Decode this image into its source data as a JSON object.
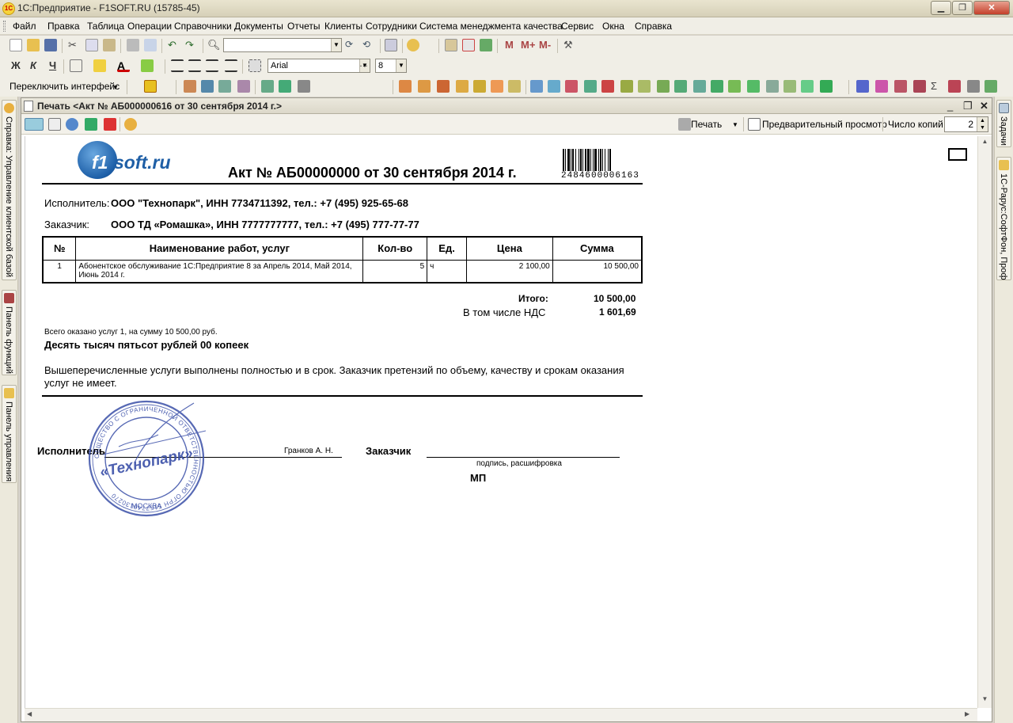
{
  "window": {
    "title": "1С:Предприятие - F1SOFT.RU (15785-45)"
  },
  "menu": [
    "Файл",
    "Правка",
    "Таблица",
    "Операции",
    "Справочники",
    "Документы",
    "Отчеты",
    "Клиенты",
    "Сотрудники",
    "Система менеджмента качества",
    "Сервис",
    "Окна",
    "Справка"
  ],
  "format_toolbar": {
    "font_name": "Arial",
    "font_size": "8",
    "bold_letter": "Ж",
    "italic_letter": "К",
    "underline_letter": "Ч"
  },
  "main_toolbar": {
    "m_label": "M",
    "m_plus_label": "M+",
    "m_minus_label": "M-"
  },
  "interface_toolbar": {
    "switch_label": "Переключить интерфейс"
  },
  "left_panels": [
    "Справка: Управление клиентской базой",
    "Панель функций",
    "Панель управления"
  ],
  "right_panels": [
    "Задачи",
    "1С-Рарус:СофтФон, Проф"
  ],
  "doc_window": {
    "title": "Печать <Акт № АБ000000616 от 30 сентября 2014 г.>",
    "print_label": "Печать",
    "preview_label": "Предварительный просмотр",
    "copies_label": "Число копий",
    "copies_value": "2"
  },
  "document": {
    "logo_left": "f1",
    "logo_right": "soft.ru",
    "title": "Акт № АБ00000000 от 30 сентября 2014 г.",
    "barcode_number": "2484600006163",
    "executor_label": "Исполнитель:",
    "executor_value": "ООО \"Технопарк\", ИНН 7734711392, тел.: +7 (495) 925-65-68",
    "customer_label": "Заказчик:",
    "customer_value": "ООО ТД «Ромашка», ИНН 7777777777, тел.: +7 (495) 777-77-77",
    "table_headers": [
      "№",
      "Наименование работ, услуг",
      "Кол-во",
      "Ед.",
      "Цена",
      "Сумма"
    ],
    "table_rows": [
      {
        "num": "1",
        "name": "Абонентское обслуживание 1С:Предприятие 8  за Апрель 2014, Май 2014, Июнь 2014 г.",
        "qty": "5",
        "unit": "ч",
        "price": "2 100,00",
        "sum": "10 500,00"
      }
    ],
    "total_label": "Итого:",
    "total_value": "10 500,00",
    "vat_label": "В том числе НДС",
    "vat_value": "1 601,69",
    "summary_line": "Всего оказано услуг 1, на сумму 10 500,00 руб.",
    "amount_words": "Десять тысяч пятьсот рублей 00 копеек",
    "statement": "Вышеперечисленные услуги выполнены полностью и в срок. Заказчик претензий по объему, качеству и срокам оказания услуг не имеет.",
    "sign_executor_label": "Исполнитель",
    "sign_executor_name": "Гранков А. Н.",
    "sign_customer_label": "Заказчик",
    "sign_caption": "подпись, расшифровка",
    "seal_label": "МП",
    "stamp_center": "«Технопарк»",
    "stamp_bottom": "МОСКВА",
    "stamp_ring": "ОБЩЕСТВО С ОГРАНИЧЕННОЙ ОТВЕТСТВЕННОСТЬЮ  ОГРН 5157746130270"
  },
  "colors": {
    "logo_blue": "#1f5fa6",
    "stamp_blue": "#3a4fa8"
  }
}
